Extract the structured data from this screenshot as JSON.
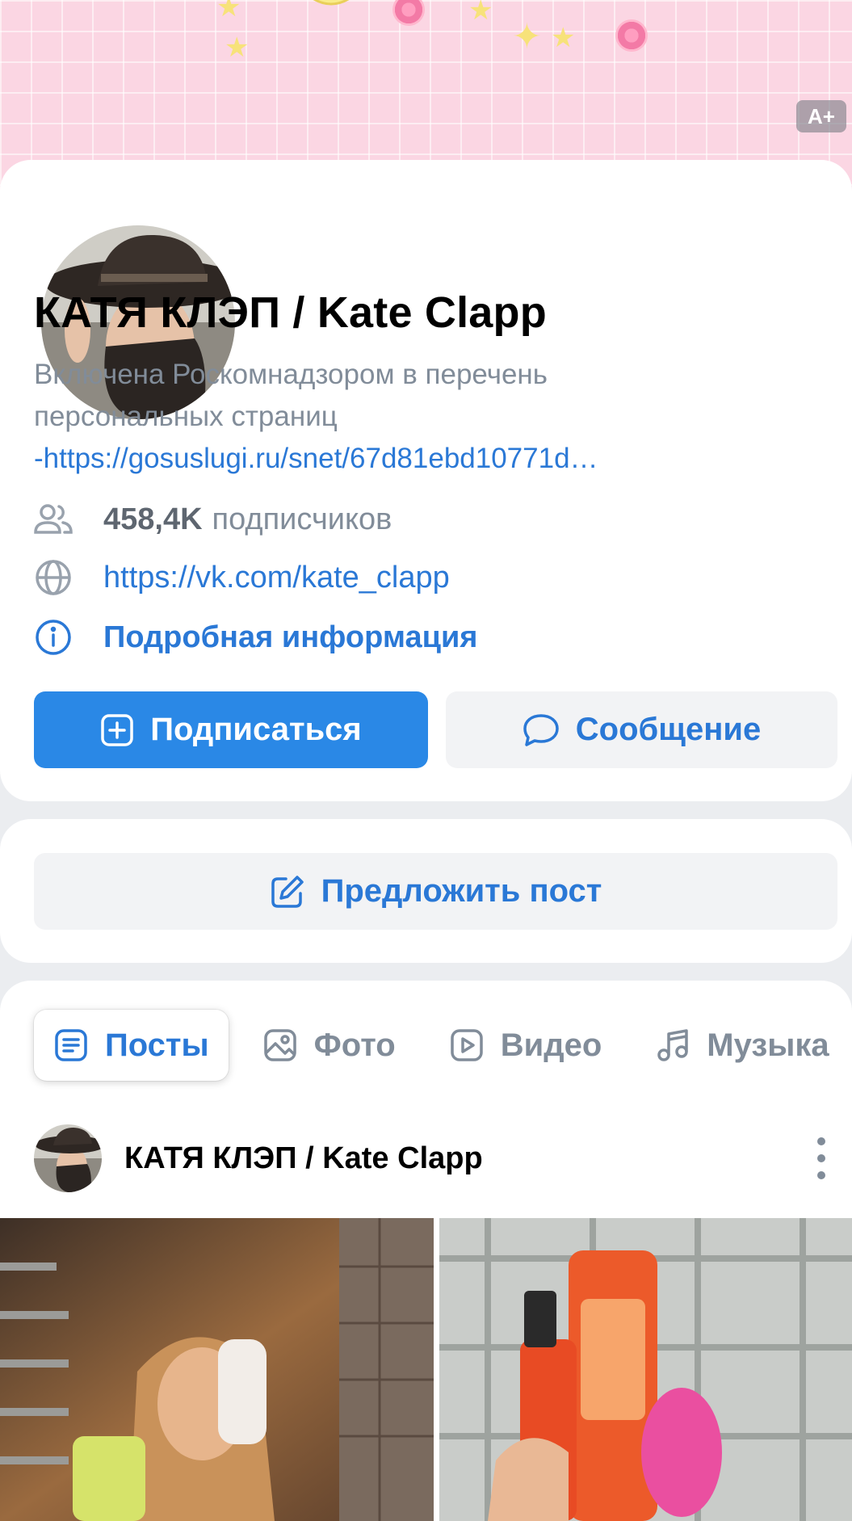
{
  "cover": {
    "badge_label": "A+"
  },
  "profile": {
    "name": "КАТЯ КЛЭП / Kate Clapp",
    "status_text": "Включена Роскомнадзором в перечень персональных страниц",
    "status_link": "-https://gosuslugi.ru/snet/67d81ebd10771d…",
    "subscribers_count": "458,4K",
    "subscribers_label": "подписчиков",
    "website": "https://vk.com/kate_clapp",
    "more_info": "Подробная информация"
  },
  "actions": {
    "subscribe_label": "Подписаться",
    "message_label": "Сообщение",
    "suggest_label": "Предложить пост"
  },
  "tabs": [
    {
      "label": "Посты",
      "icon": "posts-icon",
      "active": true
    },
    {
      "label": "Фото",
      "icon": "photo-icon",
      "active": false
    },
    {
      "label": "Видео",
      "icon": "video-icon",
      "active": false
    },
    {
      "label": "Музыка",
      "icon": "music-icon",
      "active": false
    }
  ],
  "post": {
    "author": "КАТЯ КЛЭП / Kate Clapp"
  },
  "colors": {
    "accent": "#2a88e6",
    "link": "#2a78d6",
    "muted": "#818c99",
    "cover": "#fbd6e3"
  }
}
